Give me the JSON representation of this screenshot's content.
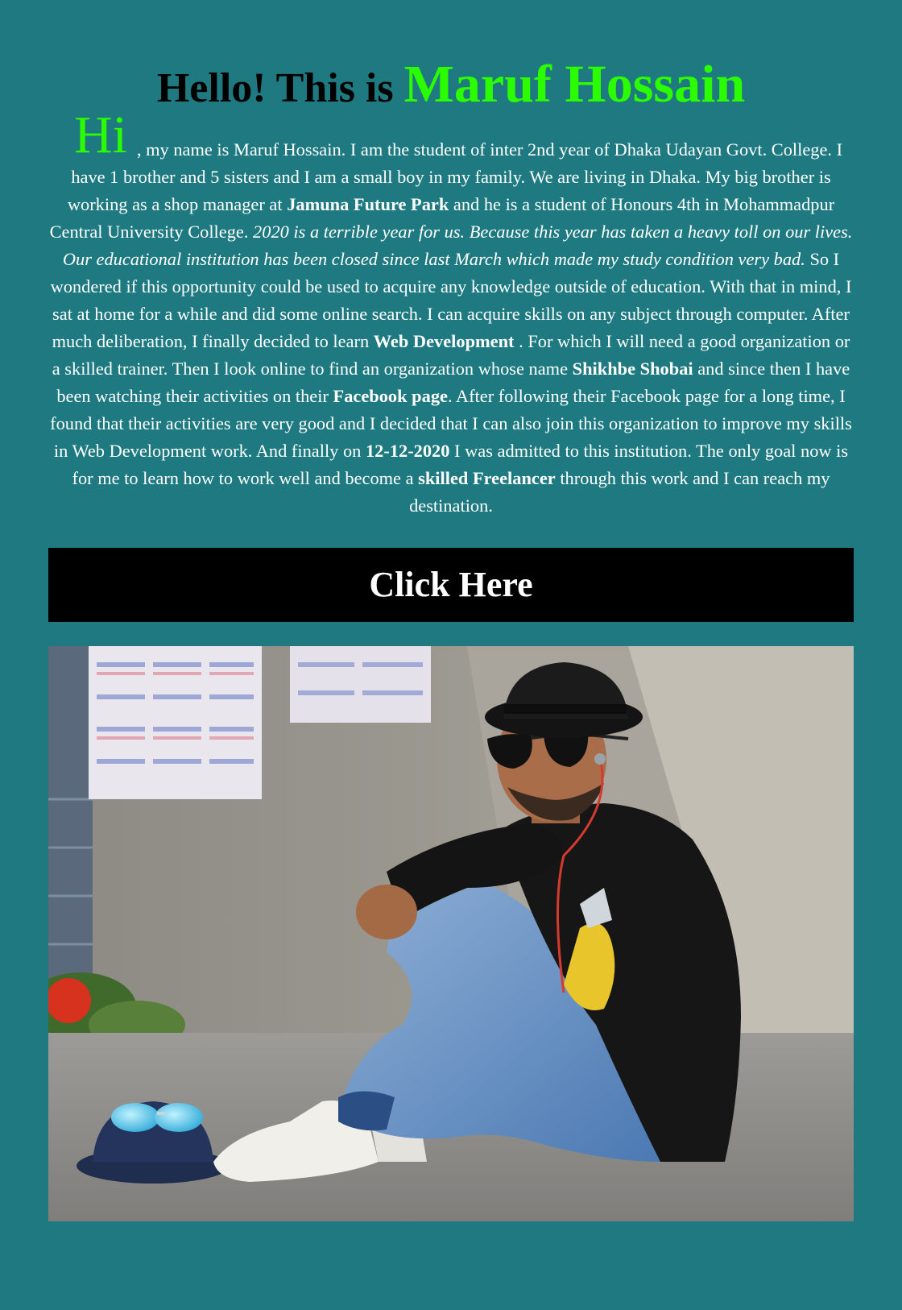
{
  "header": {
    "prefix": "Hello! This is ",
    "name": "Maruf Hossain"
  },
  "bio": {
    "hi": "Hi",
    "p1": ", my name is Maruf Hossain. I am the student of inter 2nd year of Dhaka Udayan Govt. College. I have 1 brother and 5 sisters and I am a small boy in my family. We are living in Dhaka. My big brother is working as a shop manager at ",
    "b1": "Jamuna Future Park",
    "p2": " and he is a student of Honours 4th in Mohammadpur Central University College. ",
    "i1": "2020 is a terrible year for us. Because this year has taken a heavy toll on our lives. Our educational institution has been closed since last March which made my study condition very bad.",
    "p3": " So I wondered if this opportunity could be used to acquire any knowledge outside of education. With that in mind, I sat at home for a while and did some online search. I can acquire skills on any subject through computer. After much deliberation, I finally decided to learn ",
    "b2": "Web Development",
    "p4": " . For which I will need a good organization or a skilled trainer. Then I look online to find an organization whose name ",
    "b3": "Shikhbe Shobai",
    "p5": " and since then I have been watching their activities on their ",
    "b4": "Facebook page",
    "p6": ". After following their Facebook page for a long time, I found that their activities are very good and I decided that I can also join this organization to improve my skills in Web Development work. And finally on ",
    "b5": "12-12-2020",
    "p7": " I was admitted to this institution. The only goal now is for me to learn how to work well and become a ",
    "b6": "skilled Freelancer",
    "p8": " through this work and I can reach my destination."
  },
  "cta": {
    "label": "Click Here"
  },
  "colors": {
    "background": "#1e7a80",
    "accent": "#2bfd00",
    "button": "#000000"
  }
}
